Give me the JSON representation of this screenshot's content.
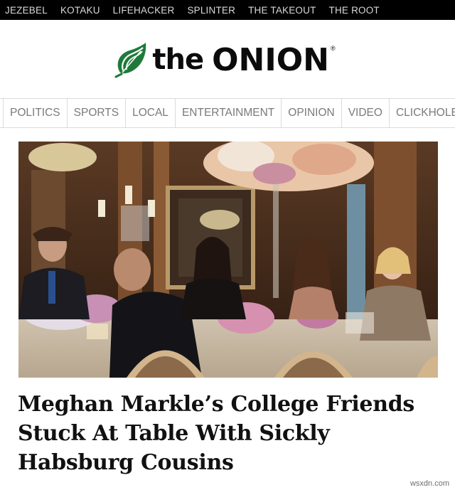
{
  "network_bar": {
    "links": [
      "JEZEBEL",
      "KOTAKU",
      "LIFEHACKER",
      "SPLINTER",
      "THE TAKEOUT",
      "THE ROOT"
    ]
  },
  "logo": {
    "the": "the",
    "onion": "ONION",
    "registered": "®"
  },
  "section_nav": {
    "items": [
      "POLITICS",
      "SPORTS",
      "LOCAL",
      "ENTERTAINMENT",
      "OPINION",
      "VIDEO",
      "CLICKHOLE"
    ]
  },
  "article": {
    "headline": "Meghan Markle’s College Friends Stuck At Table With Sickly Habsburg Cousins"
  },
  "watermark": "wsxdn.com",
  "colors": {
    "topbar_bg": "#000000",
    "logo_green": "#1f7a3a",
    "nav_text": "#7a7a7a"
  }
}
